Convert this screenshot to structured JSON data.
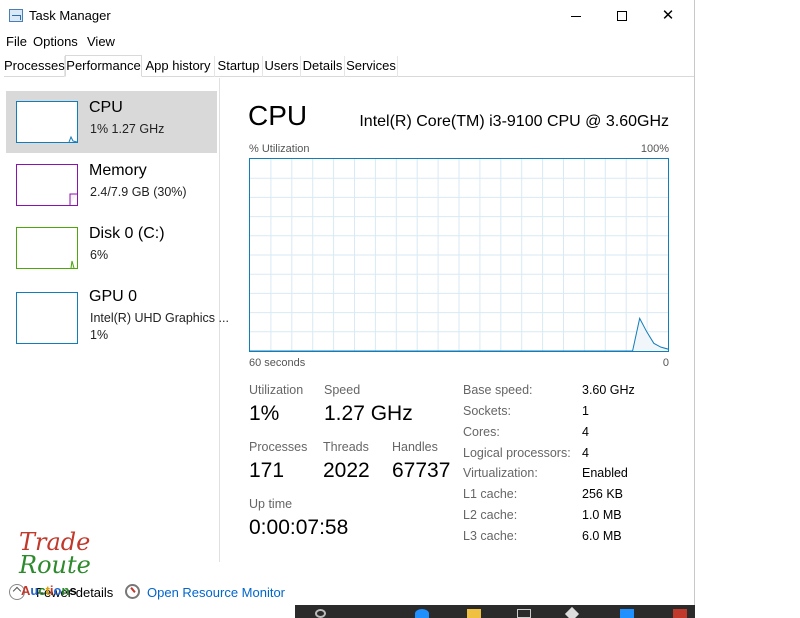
{
  "window": {
    "title": "Task Manager"
  },
  "menu": [
    "File",
    "Options",
    "View"
  ],
  "tabs": [
    "Processes",
    "Performance",
    "App history",
    "Startup",
    "Users",
    "Details",
    "Services"
  ],
  "active_tab": "Performance",
  "resources": [
    {
      "name": "CPU",
      "sub1": "1%  1.27 GHz",
      "color": "#117dbb"
    },
    {
      "name": "Memory",
      "sub1": "2.4/7.9 GB (30%)",
      "color": "#8b12ae"
    },
    {
      "name": "Disk 0 (C:)",
      "sub1": "6%",
      "color": "#4da60c"
    },
    {
      "name": "GPU 0",
      "sub1": "Intel(R) UHD Graphics ...",
      "sub2": "1%",
      "color": "#117dbb"
    }
  ],
  "detail": {
    "title": "CPU",
    "model": "Intel(R) Core(TM) i3-9100 CPU @ 3.60GHz",
    "graph": {
      "top_left": "% Utilization",
      "top_right": "100%",
      "bottom_left": "60 seconds",
      "bottom_right": "0",
      "line_color": "#117dbb",
      "fill_color": "#f1f6fa",
      "grid_color": "#d9eaf4",
      "utilization_history": [
        0,
        0,
        0,
        0,
        0,
        0,
        0,
        0,
        0,
        0,
        0,
        0,
        0,
        0,
        0,
        0,
        0,
        0,
        0,
        0,
        0,
        0,
        0,
        0,
        0,
        0,
        0,
        0,
        0,
        0,
        0,
        0,
        0,
        0,
        0,
        0,
        0,
        0,
        0,
        0,
        0,
        0,
        0,
        0,
        0,
        0,
        0,
        0,
        0,
        0,
        0,
        0,
        0,
        0,
        0,
        17,
        10,
        4,
        2,
        1
      ]
    },
    "stats": {
      "utilization_label": "Utilization",
      "utilization": "1%",
      "speed_label": "Speed",
      "speed": "1.27 GHz",
      "processes_label": "Processes",
      "processes": "171",
      "threads_label": "Threads",
      "threads": "2022",
      "handles_label": "Handles",
      "handles": "67737",
      "uptime_label": "Up time",
      "uptime": "0:00:07:58"
    },
    "specs": [
      {
        "label": "Base speed:",
        "value": "3.60 GHz"
      },
      {
        "label": "Sockets:",
        "value": "1"
      },
      {
        "label": "Cores:",
        "value": "4"
      },
      {
        "label": "Logical processors:",
        "value": "4"
      },
      {
        "label": "Virtualization:",
        "value": "Enabled"
      },
      {
        "label": "L1 cache:",
        "value": "256 KB"
      },
      {
        "label": "L2 cache:",
        "value": "1.0 MB"
      },
      {
        "label": "L3 cache:",
        "value": "6.0 MB"
      }
    ]
  },
  "footer": {
    "fewer_details": "Fewer details",
    "open_resource_monitor": "Open Resource Monitor"
  },
  "watermark": {
    "line1": "Trade",
    "line2": "Route",
    "line3": "Auctions"
  }
}
